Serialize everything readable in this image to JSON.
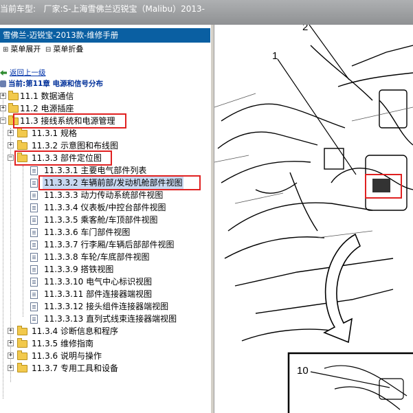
{
  "window": {
    "title": "当前车型:   厂家:S-上海雪佛兰迈锐宝（Malibu）2013-"
  },
  "pane": {
    "header": "雪佛兰-迈锐宝-2013款-维修手册"
  },
  "toolbar": {
    "expand_label": "菜单展开",
    "collapse_label": "菜单折叠"
  },
  "nav": {
    "back_label": "返回上一级",
    "current_label": "当前:第11章 电源和信号分布"
  },
  "tree": {
    "items": [
      {
        "label": "11.1 数据通信"
      },
      {
        "label": "11.2 电源插座"
      },
      {
        "label": "11.3 接线系统和电源管理"
      },
      {
        "label": "11.3.1 规格"
      },
      {
        "label": "11.3.2 示意图和布线图"
      },
      {
        "label": "11.3.3 部件定位图"
      },
      {
        "label": "11.3.3.1 主要电气部件列表"
      },
      {
        "label": "11.3.3.2 车辆前部/发动机舱部件视图"
      },
      {
        "label": "11.3.3.3 动力传动系统部件视图"
      },
      {
        "label": "11.3.3.4 仪表板/中控台部件视图"
      },
      {
        "label": "11.3.3.5 乘客舱/车顶部件视图"
      },
      {
        "label": "11.3.3.6 车门部件视图"
      },
      {
        "label": "11.3.3.7 行李厢/车辆后部部件视图"
      },
      {
        "label": "11.3.3.8 车轮/车底部件视图"
      },
      {
        "label": "11.3.3.9 搭铁视图"
      },
      {
        "label": "11.3.3.10 电气中心标识视图"
      },
      {
        "label": "11.3.3.11 部件连接器端视图"
      },
      {
        "label": "11.3.3.12 接头组件连接器端视图"
      },
      {
        "label": "11.3.3.13 直列式线束连接器端视图"
      },
      {
        "label": "11.3.4 诊断信息和程序"
      },
      {
        "label": "11.3.5 维修指南"
      },
      {
        "label": "11.3.6 说明与操作"
      },
      {
        "label": "11.3.7 专用工具和设备"
      }
    ]
  },
  "diagram": {
    "callouts": [
      "1",
      "2",
      "10"
    ]
  },
  "colors": {
    "highlight_box": "#e02020",
    "header_blue": "#0a5fa2",
    "selected_bg": "#c8d8f0"
  }
}
